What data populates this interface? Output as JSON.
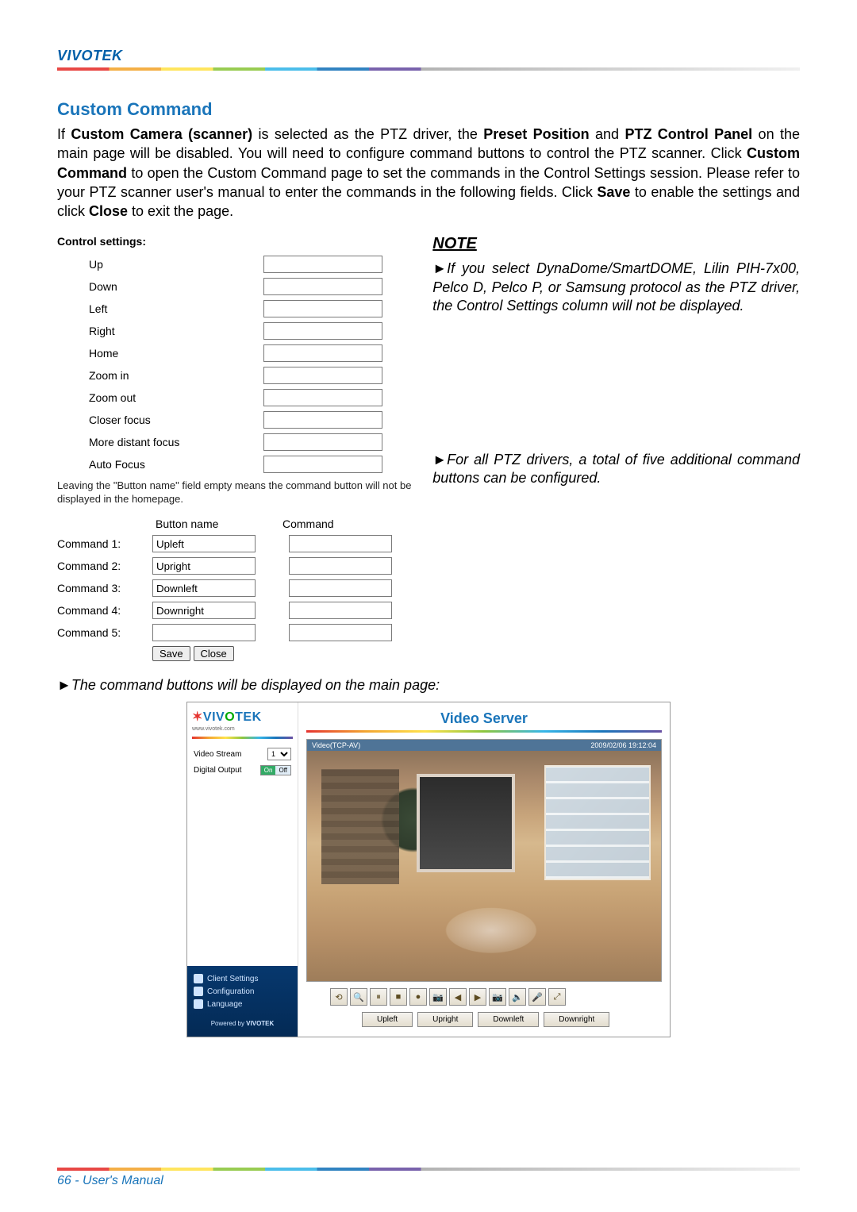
{
  "brand": "VIVOTEK",
  "section_title": "Custom Command",
  "intro_parts": {
    "p1": "If ",
    "b1": "Custom Camera (scanner)",
    "p2": " is selected as the PTZ driver, the ",
    "b2": "Preset Position",
    "p3": " and ",
    "b3": "PTZ Control Panel",
    "p4": " on the main page will be disabled. You will need to configure command buttons to control the PTZ scanner. Click ",
    "b4": "Custom Command",
    "p5": " to open the Custom Command page to set the commands in the Control Settings session. Please refer to your PTZ scanner user's manual to enter the commands in the following fields. Click ",
    "b5": "Save",
    "p6": " to enable the settings and click ",
    "b6": "Close",
    "p7": " to exit the page."
  },
  "control_settings_title": "Control settings:",
  "controls": [
    "Up",
    "Down",
    "Left",
    "Right",
    "Home",
    "Zoom in",
    "Zoom out",
    "Closer focus",
    "More distant focus",
    "Auto Focus"
  ],
  "leaving_note": "Leaving the \"Button name\" field empty means the command button will not be displayed in the homepage.",
  "cmd_headers": {
    "name": "Button name",
    "cmd": "Command"
  },
  "commands": [
    {
      "label": "Command 1:",
      "name": "Upleft",
      "cmd": ""
    },
    {
      "label": "Command 2:",
      "name": "Upright",
      "cmd": ""
    },
    {
      "label": "Command 3:",
      "name": "Downleft",
      "cmd": ""
    },
    {
      "label": "Command 4:",
      "name": "Downright",
      "cmd": ""
    },
    {
      "label": "Command 5:",
      "name": "",
      "cmd": ""
    }
  ],
  "buttons": {
    "save": "Save",
    "close": "Close"
  },
  "note_title": "NOTE",
  "note1": "If you select DynaDome/SmartDOME, Lilin PIH-7x00, Pelco D, Pelco P, or Samsung protocol as the PTZ driver, the Control Settings column will not be displayed.",
  "note2": "For all PTZ drivers, a total of five additional command buttons can be configured.",
  "result_line": "The command buttons will be displayed on the main page:",
  "preview": {
    "logo_pre": "VIV",
    "logo_o": "O",
    "logo_post": "TEK",
    "logo_sub": "www.vivotek.com",
    "video_stream_label": "Video Stream",
    "video_stream_value": "1",
    "digital_output_label": "Digital Output",
    "do_on": "On",
    "do_off": "Off",
    "links": {
      "client": "Client Settings",
      "config": "Configuration",
      "lang": "Language"
    },
    "powered_pre": "Powered by ",
    "powered_brand": "VIVOTEK",
    "right_title": "Video Server",
    "vhdr_left": "Video(TCP-AV)",
    "vhdr_right": "2009/02/06 19:12:04",
    "toolbar_icons": [
      "⟲",
      "🔍",
      "⏸",
      "■",
      "●",
      "📷",
      "◀",
      "▶",
      "📷",
      "🔈",
      "🎤",
      "⤢"
    ],
    "cmd_buttons": [
      "Upleft",
      "Upright",
      "Downleft",
      "Downright"
    ]
  },
  "footer": "66 - User's Manual"
}
